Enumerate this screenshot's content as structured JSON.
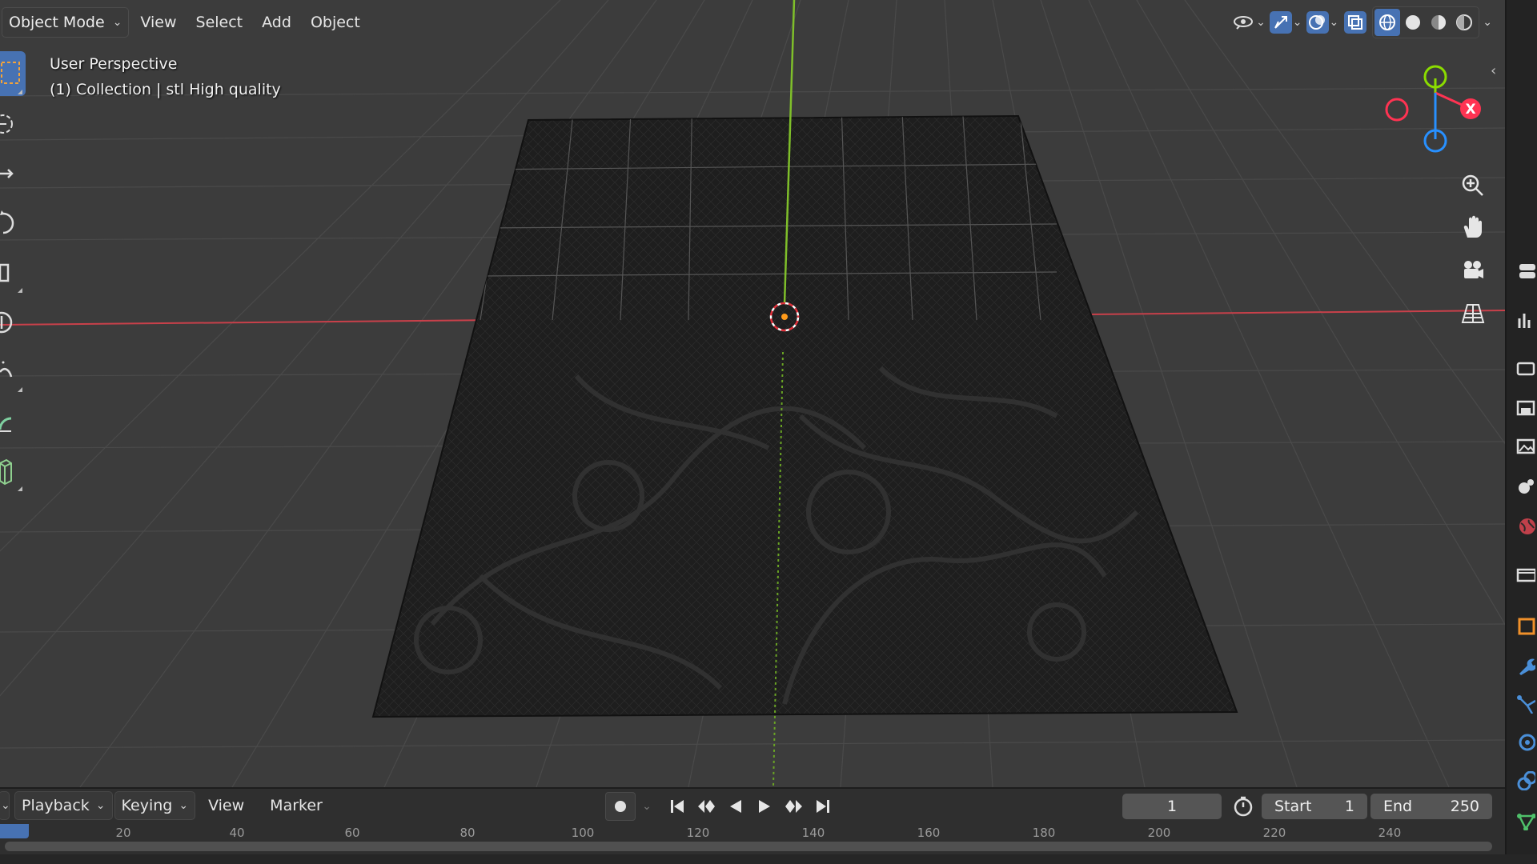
{
  "header": {
    "mode_label": "Object Mode",
    "menus": [
      "View",
      "Select",
      "Add",
      "Object"
    ]
  },
  "viewport_info": {
    "view_name": "User Perspective",
    "collection": "(1) Collection | stl High quality"
  },
  "gizmo": {
    "x_label": "X"
  },
  "timeline": {
    "menus": {
      "playback": "Playback",
      "keying": "Keying",
      "view": "View",
      "marker": "Marker"
    },
    "current_frame": "1",
    "start_label": "Start",
    "start_value": "1",
    "end_label": "End",
    "end_value": "250",
    "ruler": [
      "20",
      "40",
      "60",
      "80",
      "100",
      "120",
      "140",
      "160",
      "180",
      "200",
      "220",
      "240"
    ]
  },
  "colors": {
    "accent": "#4772b3",
    "x_axis": "#ff3352",
    "y_axis": "#8bdc00",
    "z_axis": "#2890ff",
    "viewport_bg": "#3c3c3c"
  }
}
